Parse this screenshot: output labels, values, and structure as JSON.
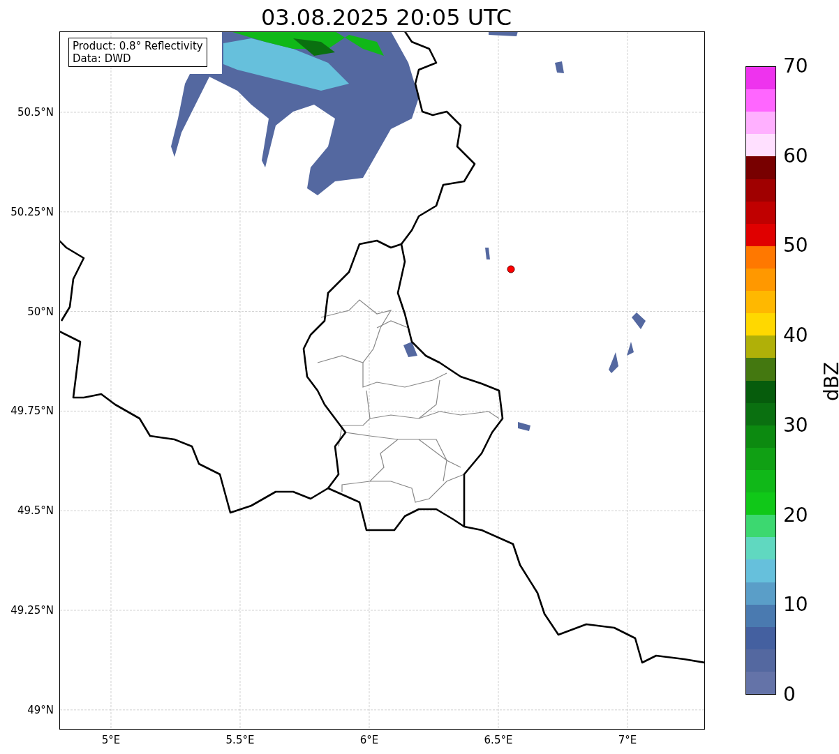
{
  "title": "03.08.2025 20:05 UTC",
  "info_box": [
    "Product: 0.8° Reflectivity",
    "Data: DWD"
  ],
  "map": {
    "lat_labels": [
      "50.5°N",
      "50.25°N",
      "50°N",
      "49.75°N",
      "49.5°N",
      "49.25°N",
      "49°N"
    ],
    "lon_labels": [
      "5°E",
      "5.5°E",
      "6°E",
      "6.5°E",
      "7°E"
    ]
  },
  "colorbar": {
    "label": "dBZ",
    "ticks": [
      "70",
      "60",
      "50",
      "40",
      "30",
      "20",
      "10",
      "0"
    ],
    "segments": [
      {
        "color": "#ee33ee"
      },
      {
        "color": "#ff66ff"
      },
      {
        "color": "#ffb0ff"
      },
      {
        "color": "#ffe0ff"
      },
      {
        "color": "#780000"
      },
      {
        "color": "#a00000"
      },
      {
        "color": "#c00000"
      },
      {
        "color": "#e00000"
      },
      {
        "color": "#ff7800"
      },
      {
        "color": "#ff9800"
      },
      {
        "color": "#ffb800"
      },
      {
        "color": "#ffd800"
      },
      {
        "color": "#b0b008"
      },
      {
        "color": "#447810"
      },
      {
        "color": "#065c0c"
      },
      {
        "color": "#0a7010"
      },
      {
        "color": "#0c8a10"
      },
      {
        "color": "#10a014"
      },
      {
        "color": "#10b818"
      },
      {
        "color": "#10c818"
      },
      {
        "color": "#3cd870"
      },
      {
        "color": "#60d8c0"
      },
      {
        "color": "#66c0dc"
      },
      {
        "color": "#5a9ec8"
      },
      {
        "color": "#4a7ab0"
      },
      {
        "color": "#4460a0"
      },
      {
        "color": "#5468a0"
      },
      {
        "color": "#6473a8"
      }
    ]
  }
}
